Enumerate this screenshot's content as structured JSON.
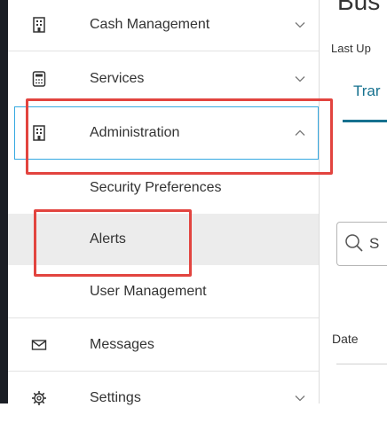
{
  "sidebar": {
    "items": [
      {
        "label": "Cash Management",
        "icon": "building-icon",
        "expanded": false
      },
      {
        "label": "Services",
        "icon": "calculator-icon",
        "expanded": false
      },
      {
        "label": "Administration",
        "icon": "building-icon",
        "expanded": true,
        "subitems": [
          {
            "label": "Security Preferences"
          },
          {
            "label": "Alerts",
            "active": true
          },
          {
            "label": "User Management"
          }
        ]
      },
      {
        "label": "Messages",
        "icon": "envelope-icon"
      },
      {
        "label": "Settings",
        "icon": "gear-icon",
        "expanded": false
      }
    ]
  },
  "main": {
    "heading": "Bus",
    "last_updated": "Last Up",
    "tab_label": "Trar",
    "search_placeholder": "S",
    "column_header": "Date"
  },
  "colors": {
    "highlight": "#e2443f",
    "focus_outline": "#36a9e1",
    "accent": "#16718f",
    "active_bg": "#ececec"
  }
}
